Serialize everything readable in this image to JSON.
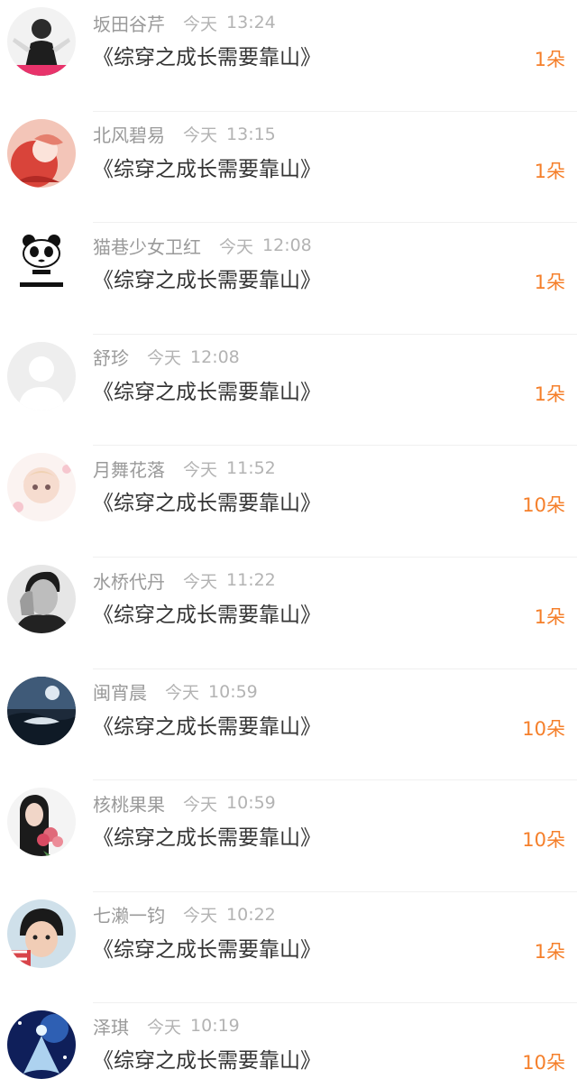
{
  "colors": {
    "accent": "#f57f2a",
    "name_text": "#9a9a9a",
    "time_text": "#b3b3b3",
    "title_text": "#333333",
    "divider": "#f0f0f0"
  },
  "entries": [
    {
      "name": "坂田谷芹",
      "day": "今天",
      "time": "13:24",
      "book": "《综穿之成长需要靠山》",
      "gift": "1朵",
      "avatar": "avatar-woman-photo"
    },
    {
      "name": "北风碧易",
      "day": "今天",
      "time": "13:15",
      "book": "《综穿之成长需要靠山》",
      "gift": "1朵",
      "avatar": "avatar-anime-art"
    },
    {
      "name": "猫巷少女卫红",
      "day": "今天",
      "time": "12:08",
      "book": "《综穿之成长需要靠山》",
      "gift": "1朵",
      "avatar": "avatar-panda-meme"
    },
    {
      "name": "舒珍",
      "day": "今天",
      "time": "12:08",
      "book": "《综穿之成长需要靠山》",
      "gift": "1朵",
      "avatar": "avatar-default-silhouette"
    },
    {
      "name": "月舞花落",
      "day": "今天",
      "time": "11:52",
      "book": "《综穿之成长需要靠山》",
      "gift": "10朵",
      "avatar": "avatar-chibi-anime"
    },
    {
      "name": "水桥代丹",
      "day": "今天",
      "time": "11:22",
      "book": "《综穿之成长需要靠山》",
      "gift": "1朵",
      "avatar": "avatar-man-bw-photo"
    },
    {
      "name": "闽宵晨",
      "day": "今天",
      "time": "10:59",
      "book": "《综穿之成长需要靠山》",
      "gift": "10朵",
      "avatar": "avatar-night-scene"
    },
    {
      "name": "核桃果果",
      "day": "今天",
      "time": "10:59",
      "book": "《综穿之成长需要靠山》",
      "gift": "10朵",
      "avatar": "avatar-girl-flowers"
    },
    {
      "name": "七濑一钧",
      "day": "今天",
      "time": "10:22",
      "book": "《综穿之成长需要靠山》",
      "gift": "1朵",
      "avatar": "avatar-child-photo"
    },
    {
      "name": "泽琪",
      "day": "今天",
      "time": "10:19",
      "book": "《综穿之成长需要靠山》",
      "gift": "10朵",
      "avatar": "avatar-glowing-figure"
    }
  ]
}
